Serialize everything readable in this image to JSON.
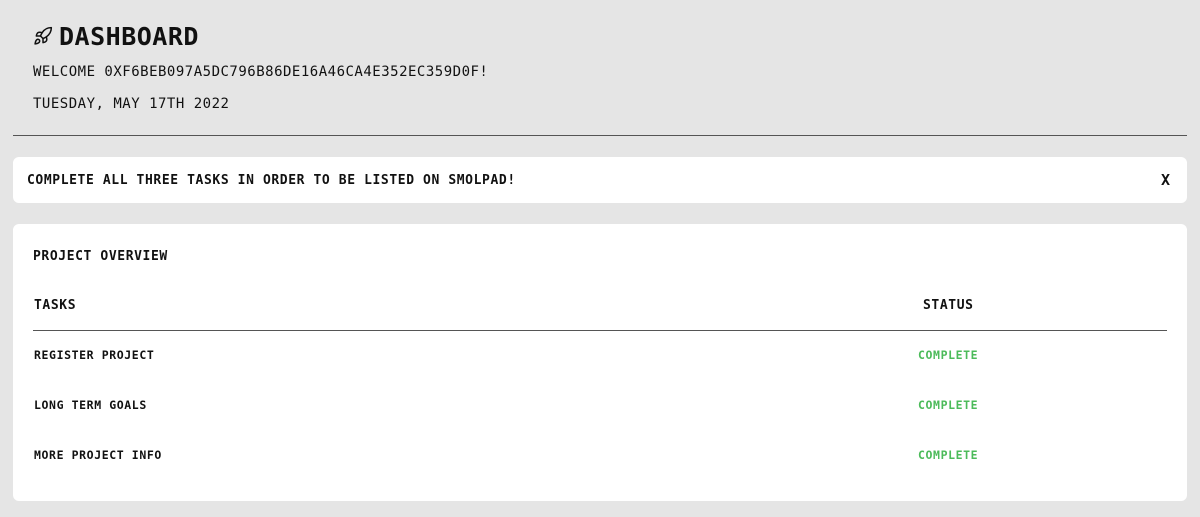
{
  "header": {
    "icon": "rocket-icon",
    "title": "DASHBOARD",
    "welcome": "WELCOME 0XF6BEB097A5DC796B86DE16A46CA4E352EC359D0F!",
    "date": "TUESDAY, MAY 17TH 2022"
  },
  "notice": {
    "text": "COMPLETE ALL THREE TASKS IN ORDER TO BE LISTED ON SMOLPAD!",
    "close_label": "X"
  },
  "overview": {
    "title": "PROJECT OVERVIEW",
    "columns": [
      "TASKS",
      "STATUS"
    ],
    "rows": [
      {
        "task": "REGISTER PROJECT",
        "status": "COMPLETE"
      },
      {
        "task": "LONG TERM GOALS",
        "status": "COMPLETE"
      },
      {
        "task": "MORE PROJECT INFO",
        "status": "COMPLETE"
      }
    ]
  },
  "colors": {
    "background": "#e5e5e5",
    "card": "#ffffff",
    "status_complete": "#4cbb5a"
  }
}
